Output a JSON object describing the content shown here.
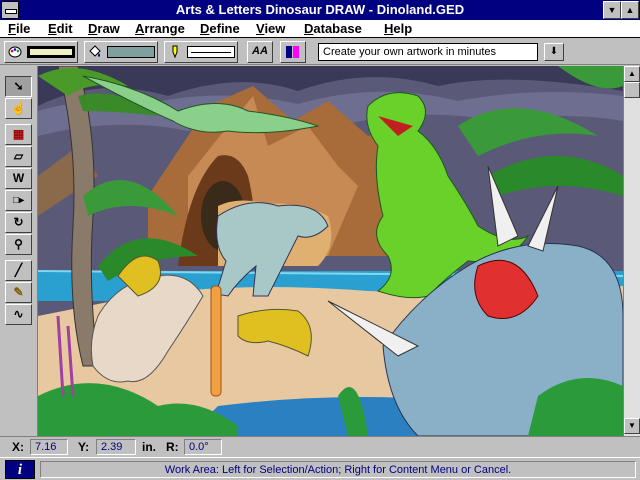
{
  "window": {
    "title": "Arts & Letters Dinosaur DRAW - Dinoland.GED"
  },
  "menu": {
    "items": [
      "File",
      "Edit",
      "Draw",
      "Arrange",
      "Define",
      "View",
      "Database",
      "Help"
    ]
  },
  "toolbar": {
    "fill_color": "#000000",
    "fill_inner": "#f0f0c0",
    "bg_color": "#80a0a0",
    "font_button_label": "AA",
    "text_field_value": "Create your own artwork in minutes"
  },
  "tools": [
    {
      "name": "selection-arrow-icon",
      "glyph": "➘"
    },
    {
      "name": "hand-icon",
      "glyph": "☝"
    },
    {
      "name": "symbol-library-icon",
      "glyph": "▦"
    },
    {
      "name": "shapes-icon",
      "glyph": "▱"
    },
    {
      "name": "text-icon",
      "glyph": "W"
    },
    {
      "name": "connector-icon",
      "glyph": "□▸"
    },
    {
      "name": "rotate-icon",
      "glyph": "↻"
    },
    {
      "name": "zoom-icon",
      "glyph": "⚲"
    },
    {
      "name": "line-icon",
      "glyph": "╱"
    },
    {
      "name": "pen-icon",
      "glyph": "✎"
    },
    {
      "name": "freehand-icon",
      "glyph": "∿"
    }
  ],
  "coordinates": {
    "x_label": "X:",
    "x_value": "7.16",
    "y_label": "Y:",
    "y_value": "2.39",
    "unit": "in.",
    "r_label": "R:",
    "r_value": "0.0°"
  },
  "status": {
    "info_label": "i",
    "message": "Work Area: Left for Selection/Action; Right for Content Menu or Cancel."
  }
}
